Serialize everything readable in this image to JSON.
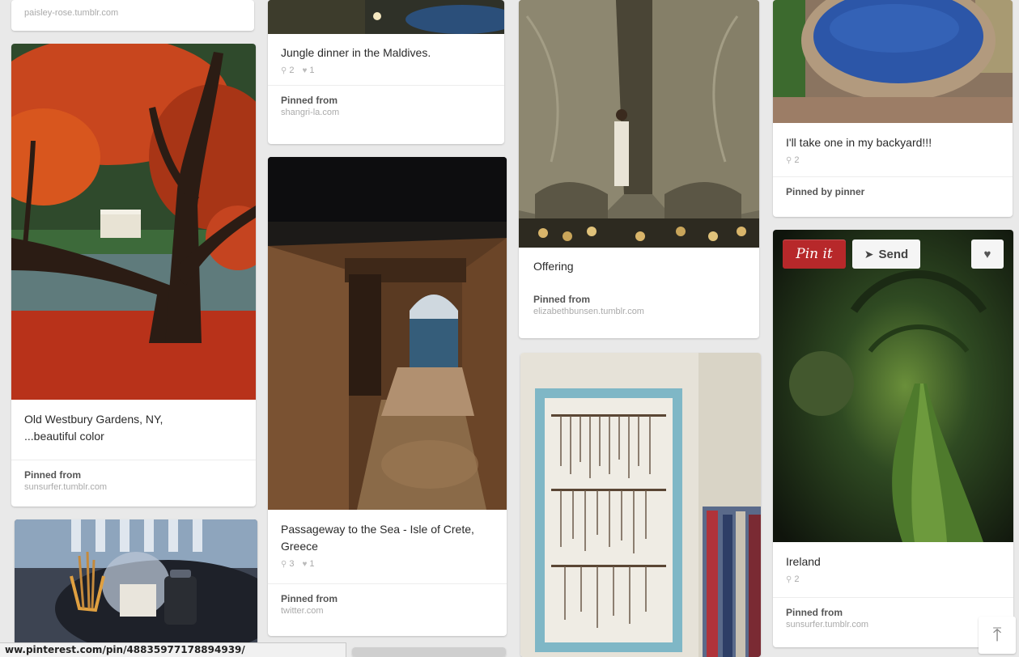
{
  "pins": [
    {
      "id": "paisley",
      "pinned_label": "",
      "source": "paisley-rose.tumblr.com"
    },
    {
      "id": "old-westbury",
      "description": "Old Westbury Gardens, NY, ...beautiful color",
      "pinned_label": "Pinned from",
      "source": "sunsurfer.tumblr.com"
    },
    {
      "id": "jungle-dinner",
      "description": "Jungle dinner in the Maldives.",
      "repins": "2",
      "likes": "1",
      "pinned_label": "Pinned from",
      "source": "shangri-la.com"
    },
    {
      "id": "passageway",
      "description": "Passageway to the Sea - Isle of Crete, Greece",
      "repins": "3",
      "likes": "1",
      "pinned_label": "Pinned from",
      "source": "twitter.com"
    },
    {
      "id": "offering",
      "description": "Offering",
      "pinned_label": "Pinned from",
      "source": "elizabethbunsen.tumblr.com"
    },
    {
      "id": "backyard",
      "description": "I'll take one in my backyard!!!",
      "repins": "2",
      "pinned_label": "Pinned by pinner"
    },
    {
      "id": "ireland",
      "description": "Ireland",
      "repins": "2",
      "pinned_label": "Pinned from",
      "source": "sunsurfer.tumblr.com"
    }
  ],
  "hover_buttons": {
    "pin_it": "Pin it",
    "send": "Send"
  },
  "icons": {
    "repin": "pushpin-icon",
    "like": "heart-icon",
    "send": "paper-plane-icon",
    "scroll_top": "arrow-up-icon"
  },
  "status_bar": {
    "url": "ww.pinterest.com/pin/48835977178894939/"
  },
  "colors": {
    "pin_it_red": "#b7282a",
    "background": "#e9e9e9"
  }
}
